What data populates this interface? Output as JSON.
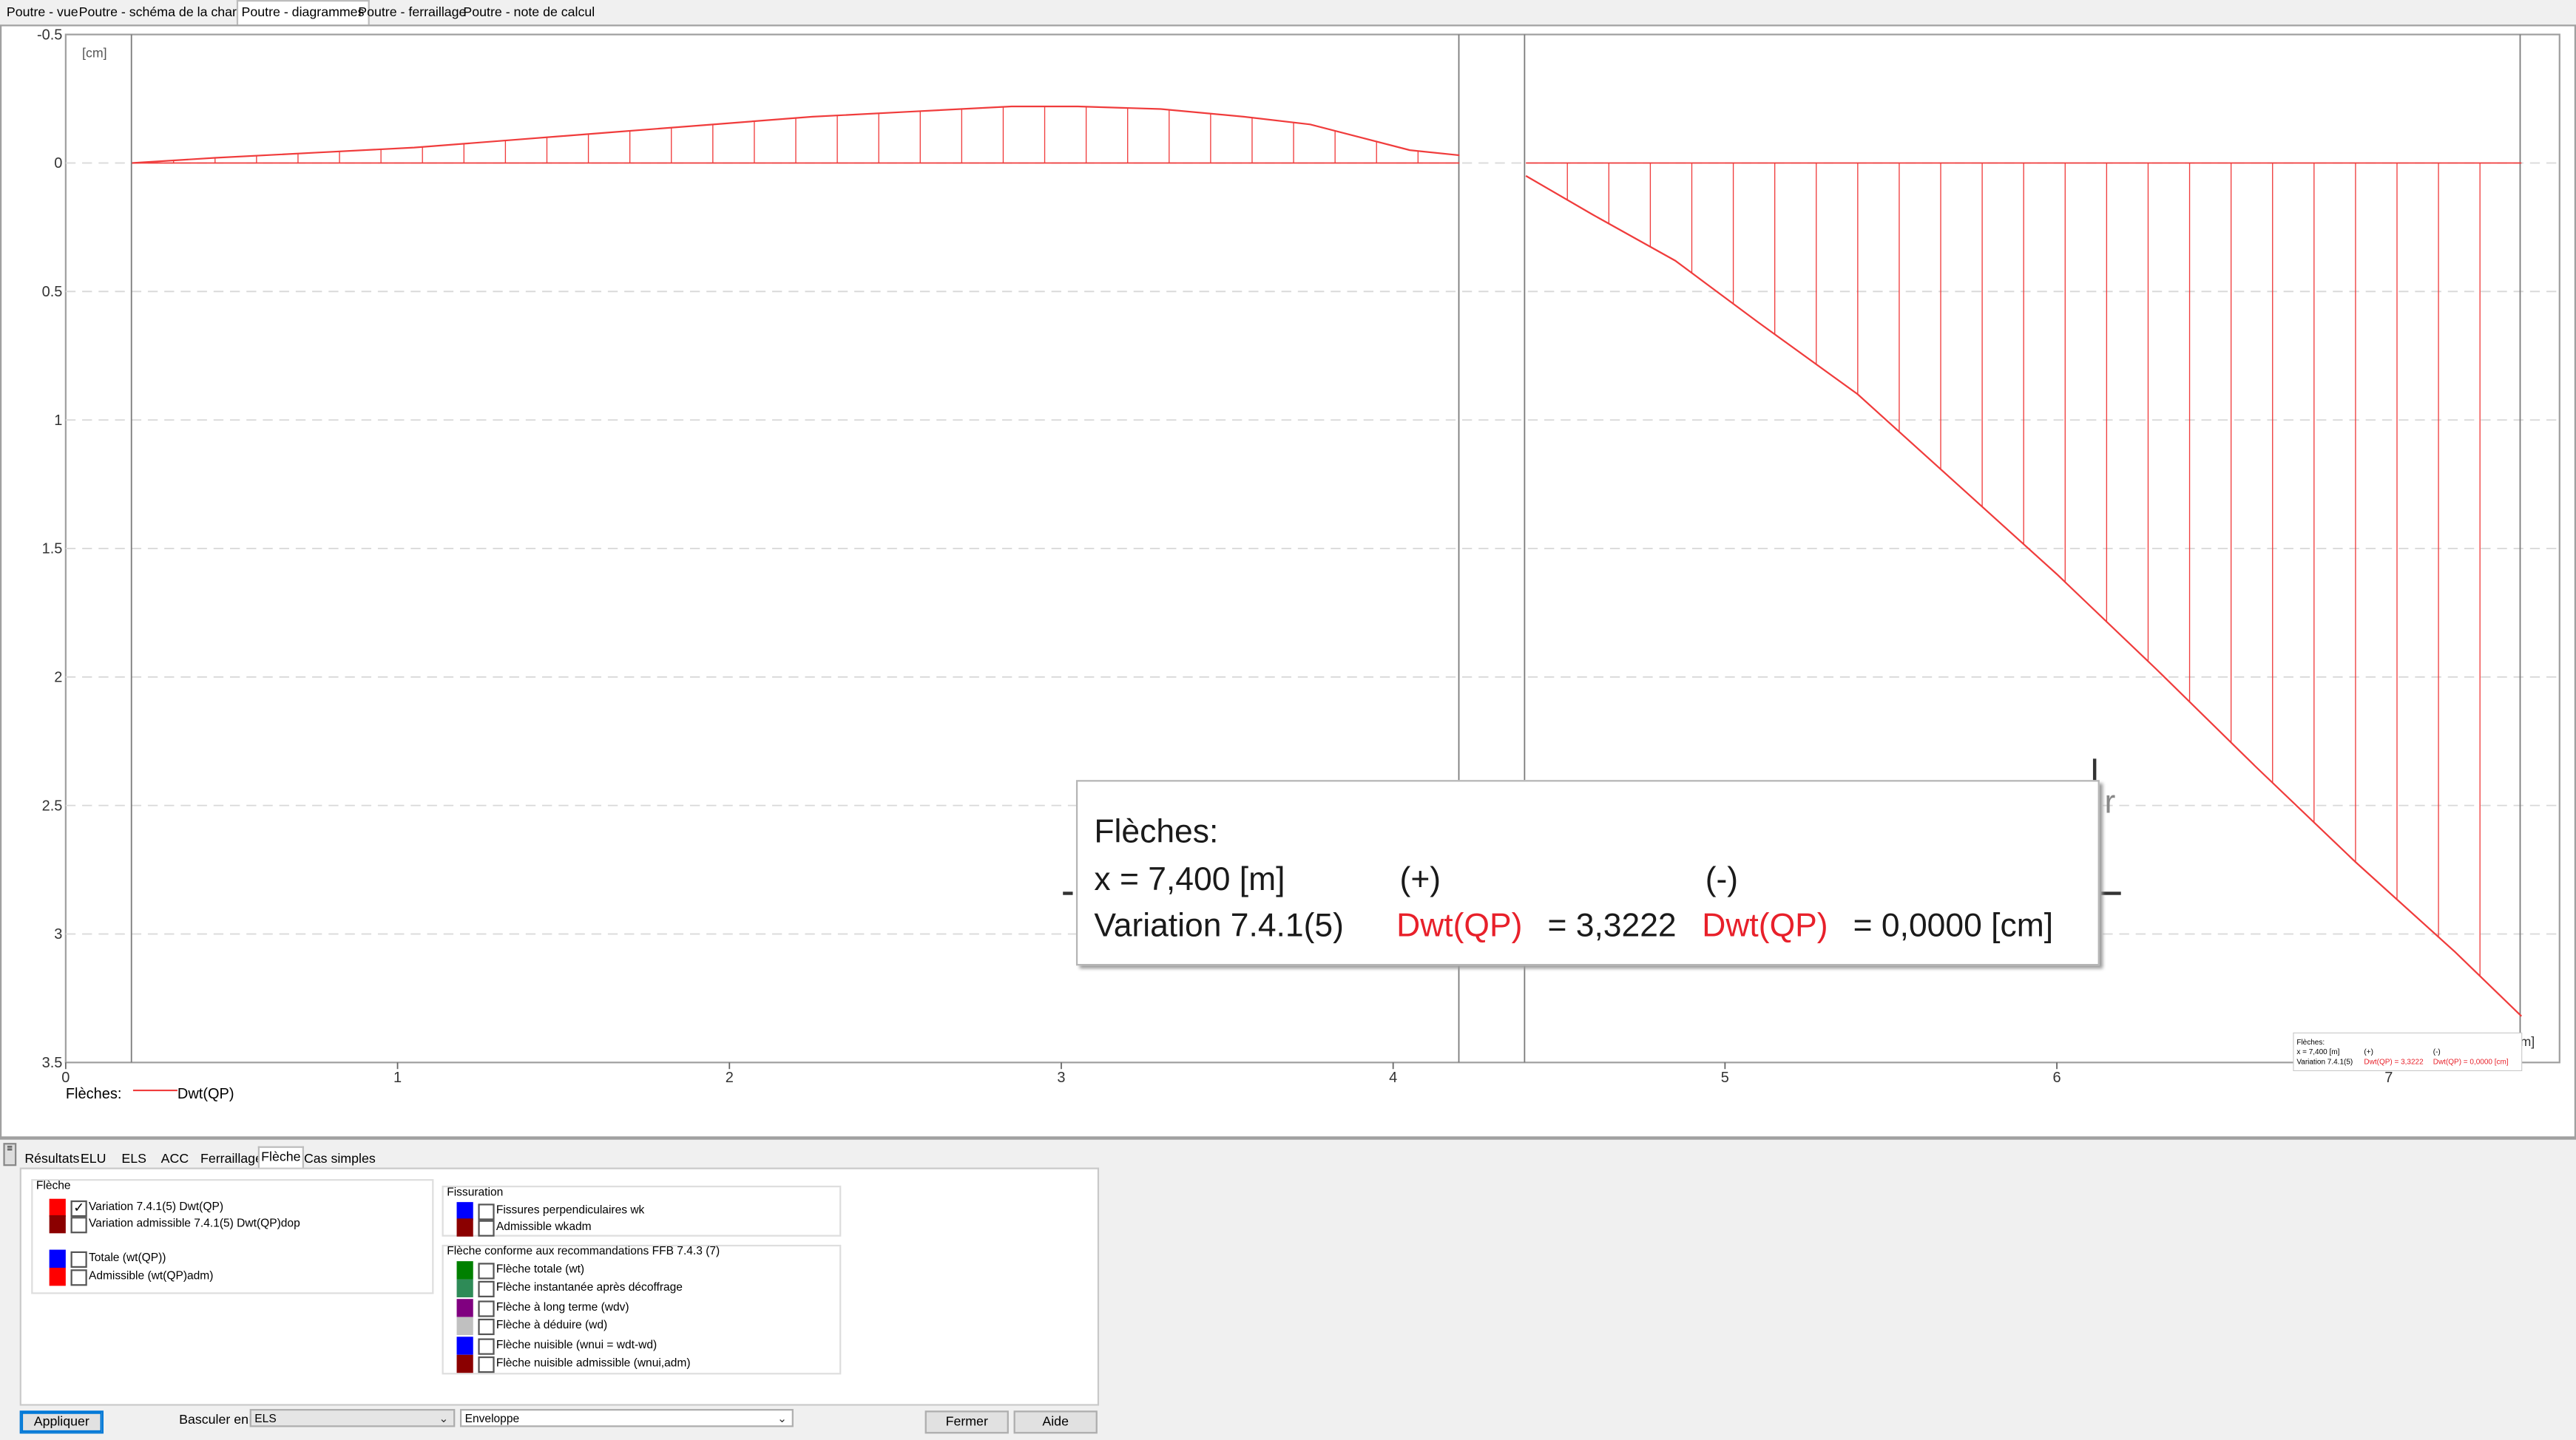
{
  "top_tabs": [
    "Poutre - vue",
    "Poutre - schéma de la charge",
    "Poutre - diagrammes",
    "Poutre - ferraillage",
    "Poutre - note de calcul"
  ],
  "chart": {
    "unit_label": "[cm]",
    "x_unit_fragment": "m]",
    "legend_title": "Flèches:",
    "legend_series": "Dwt(QP)",
    "series_color": "#f03c3c"
  },
  "chart_data": {
    "type": "line",
    "ylabel": "[cm]",
    "y_tick_labels": [
      "-0.5",
      "0",
      "0.5",
      "1",
      "1.5",
      "2",
      "2.5",
      "3",
      "3.5"
    ],
    "x_tick_labels": [
      "0",
      "1",
      "2",
      "3",
      "4",
      "5",
      "6",
      "7"
    ],
    "ylim": [
      -0.5,
      3.5
    ],
    "xlim": [
      0,
      7.5
    ],
    "y_inverted": true,
    "grid": "horizontal-dashed",
    "series": [
      {
        "name": "Dwt(QP)",
        "color": "#f03c3c",
        "segments": [
          {
            "x": [
              0.2,
              0.45,
              0.75,
              1.05,
              1.35,
              1.65,
              1.95,
              2.25,
              2.55,
              2.85,
              3.05,
              3.3,
              3.55,
              3.75,
              3.9,
              4.05,
              4.2
            ],
            "y": [
              0.0,
              -0.02,
              -0.04,
              -0.06,
              -0.09,
              -0.12,
              -0.15,
              -0.18,
              -0.2,
              -0.22,
              -0.22,
              -0.21,
              -0.18,
              -0.15,
              -0.1,
              -0.05,
              -0.03
            ]
          },
          {
            "x": [
              4.4,
              4.6,
              4.85,
              5.1,
              5.4,
              5.7,
              6.0,
              6.3,
              6.6,
              6.9,
              7.2,
              7.4
            ],
            "y": [
              0.05,
              0.2,
              0.38,
              0.62,
              0.9,
              1.25,
              1.6,
              1.97,
              2.35,
              2.72,
              3.07,
              3.32
            ]
          }
        ]
      }
    ]
  },
  "tooltip": {
    "title": "Flèches:",
    "x_text": "x = 7,400 [m]",
    "plus": "(+)",
    "minus": "(-)",
    "variation_label": "Variation 7.4.1(5)",
    "series_a": "Dwt(QP)",
    "value_a": "= 3,3222",
    "series_b": "Dwt(QP)",
    "value_b": "= 0,0000 [cm]"
  },
  "mini_tooltip": {
    "title": "Flèches:",
    "x_text": "x = 7,400 [m]",
    "plus": "(+)",
    "minus": "(-)",
    "line": "Variation 7.4.1(5)",
    "a": "Dwt(QP) = 3,3222",
    "b": "Dwt(QP) = 0,0000 [cm]"
  },
  "bottom_tabs": [
    "Résultats",
    "ELU",
    "ELS",
    "ACC",
    "Ferraillage",
    "Flèche",
    "Cas simples"
  ],
  "fleche_group": {
    "title": "Flèche",
    "items": [
      {
        "label": "Variation 7.4.1(5)  Dwt(QP)",
        "color": "#ff0000",
        "checked": "✓"
      },
      {
        "label": "Variation admissible 7.4.1(5)  Dwt(QP)dop",
        "color": "#8b0000",
        "checked": ""
      },
      {
        "label": "Totale (wt(QP))",
        "color": "#0000ff",
        "checked": ""
      },
      {
        "label": "Admissible (wt(QP)adm)",
        "color": "#ff0000",
        "checked": ""
      }
    ]
  },
  "fissuration_group": {
    "title": "Fissuration",
    "items": [
      {
        "label": "Fissures perpendiculaires wk",
        "color": "#0000ff",
        "checked": ""
      },
      {
        "label": "Admissible wkadm",
        "color": "#8b0000",
        "checked": ""
      }
    ]
  },
  "ffb_group": {
    "title": "Flèche conforme aux recommandations FFB 7.4.3 (7)",
    "items": [
      {
        "label": "Flèche totale (wt)",
        "color": "#008000",
        "checked": ""
      },
      {
        "label": "Flèche instantanée après décoffrage",
        "color": "#2e8b57",
        "checked": ""
      },
      {
        "label": "Flèche à long terme (wdv)",
        "color": "#800080",
        "checked": ""
      },
      {
        "label": "Flèche à déduire (wd)",
        "color": "#c0c0c0",
        "checked": ""
      },
      {
        "label": "Flèche nuisible (wnui = wdt-wd)",
        "color": "#0000ff",
        "checked": ""
      },
      {
        "label": "Flèche nuisible admissible (wnui,adm)",
        "color": "#8b0000",
        "checked": ""
      }
    ]
  },
  "footer": {
    "apply": "Appliquer",
    "switch_label": "Basculer en:",
    "switch_value": "ELS",
    "envelope_value": "Enveloppe",
    "close": "Fermer",
    "help": "Aide"
  }
}
